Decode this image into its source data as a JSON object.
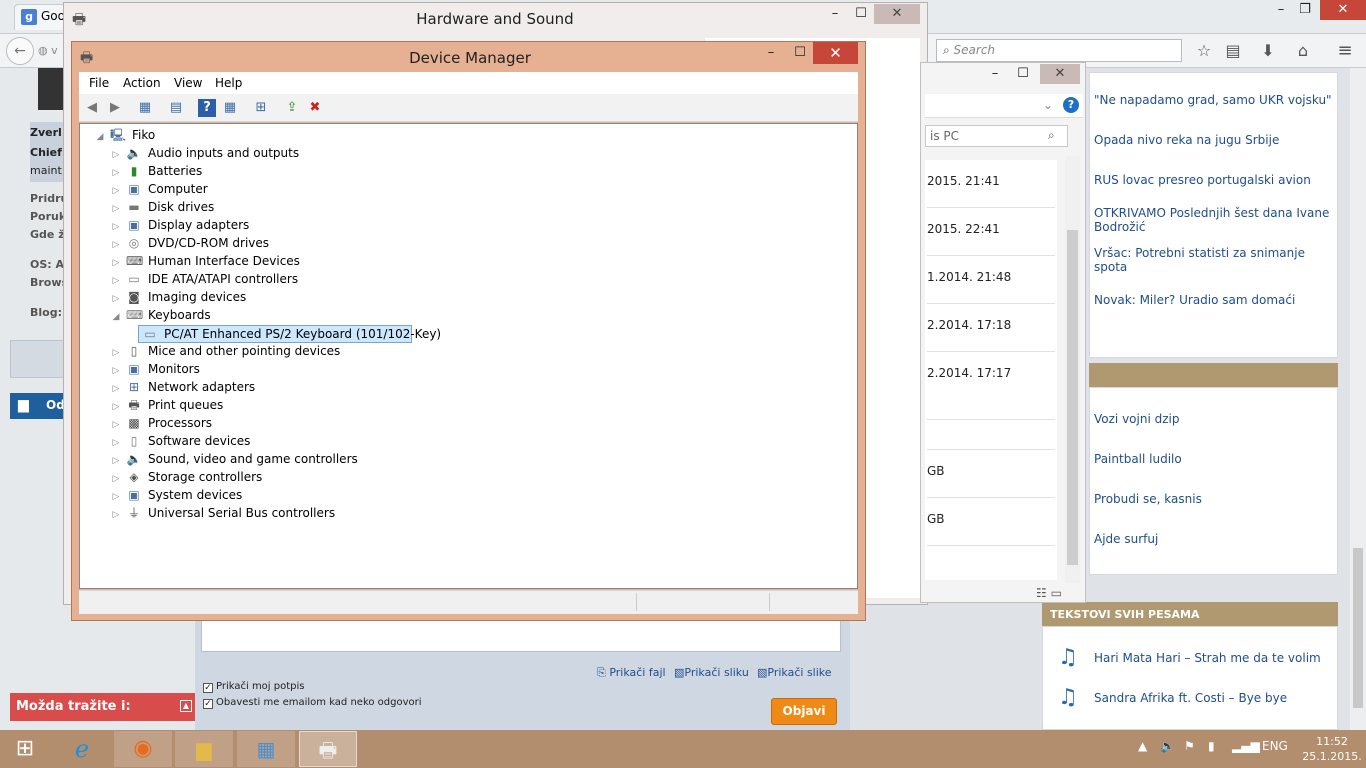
{
  "browser": {
    "tab_title": "Goo",
    "url_hint": "v",
    "search_placeholder": "Search",
    "icons": [
      "back-icon",
      "reload-icon",
      "star-icon",
      "reader-icon",
      "download-icon",
      "home-icon",
      "menu-icon"
    ]
  },
  "forum_left": {
    "badges": [
      "Zverl",
      "Chief",
      "maint"
    ],
    "fields": [
      "Pridru",
      "Poruk",
      "Gde ži"
    ],
    "os_label": "OS: Ar",
    "browser_label": "Brows",
    "blog_label": "Blog: [",
    "reply_button": "Od",
    "suggest_label": "Možda tražite i:"
  },
  "reply": {
    "attach_file": "Prikači fajl",
    "attach_image": "Prikači sliku",
    "attach_images": "Prikači slike",
    "chk_signature": "Prikači moj potpis",
    "chk_notify": "Obavesti me emailom kad neko odgovori",
    "submit": "Objavi"
  },
  "sidebar": {
    "news": [
      "\"Ne napadamo grad, samo UKR vojsku\"",
      "Opada nivo reka na jugu Srbije",
      "RUS lovac presreo portugalski avion",
      "OTKRIVAMO Poslednjih šest dana Ivane Bodrožić",
      "Vršac: Potrebni statisti za snimanje spota",
      "Novak: Miler? Uradio sam domaći"
    ],
    "games": [
      "Vozi vojni dzip",
      "Paintball ludilo",
      "Probudi se, kasnis",
      "Ajde surfuj"
    ],
    "lyrics_header": "TEKSTOVI SVIH PESAMA",
    "songs": [
      "Hari Mata Hari – Strah me da te volim",
      "Sandra Afrika ft. Costi – Bye bye"
    ]
  },
  "hs_window": {
    "title": "Hardware and Sound"
  },
  "explorer": {
    "search_text": "is PC",
    "rows": [
      "2015. 21:41",
      "2015. 22:41",
      "1.2014. 21:48",
      "2.2014. 17:18",
      "2.2014. 17:17",
      "",
      "GB",
      "GB"
    ]
  },
  "device_manager": {
    "title": "Device Manager",
    "menu": [
      "File",
      "Action",
      "View",
      "Help"
    ],
    "root": "Fiko",
    "categories": [
      "Audio inputs and outputs",
      "Batteries",
      "Computer",
      "Disk drives",
      "Display adapters",
      "DVD/CD-ROM drives",
      "Human Interface Devices",
      "IDE ATA/ATAPI controllers",
      "Imaging devices",
      "Keyboards",
      "Mice and other pointing devices",
      "Monitors",
      "Network adapters",
      "Print queues",
      "Processors",
      "Software devices",
      "Sound, video and game controllers",
      "Storage controllers",
      "System devices",
      "Universal Serial Bus controllers"
    ],
    "keyboard_device": "PC/AT Enhanced PS/2 Keyboard (101/102-Key)"
  },
  "taskbar": {
    "language": "ENG",
    "time": "11:52",
    "date": "25.1.2015."
  },
  "colors": {
    "dm_frame": "#e6b193",
    "dm_close": "#c7463a",
    "taskbar": "#b28d6e",
    "selection": "#cce8ff",
    "link": "#1f4e8c",
    "submit": "#f08a17"
  }
}
